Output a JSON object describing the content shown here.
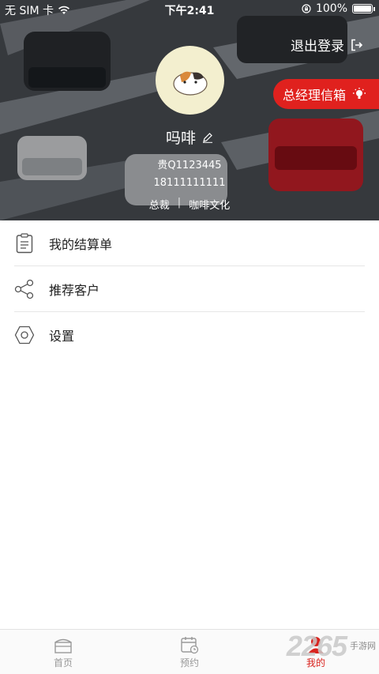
{
  "status_bar": {
    "carrier": "无 SIM 卡",
    "time": "下午2:41",
    "battery": "100%"
  },
  "header": {
    "logout_label": "退出登录",
    "mailbox_label": "总经理信箱",
    "user_name": "吗啡",
    "user_id": "贵Q1123445",
    "phone": "18111111111",
    "position": "总裁",
    "separator": "|",
    "company": "咖啡文化"
  },
  "menu": [
    {
      "label": "我的结算单",
      "icon": "clipboard-icon"
    },
    {
      "label": "推荐客户",
      "icon": "share-icon"
    },
    {
      "label": "设置",
      "icon": "hexagon-settings-icon"
    }
  ],
  "tabbar": {
    "tabs": [
      {
        "label": "首页",
        "icon": "home-icon",
        "active": false
      },
      {
        "label": "预约",
        "icon": "calendar-icon",
        "active": false
      },
      {
        "label": "我的",
        "icon": "user-icon",
        "active": true
      }
    ]
  },
  "watermark": {
    "number": "2265",
    "text_top": "手游网",
    "text_bottom": ""
  },
  "colors": {
    "accent": "#d9231e",
    "mailbox": "#e0211e",
    "avatar_bg": "#f3efcf"
  }
}
